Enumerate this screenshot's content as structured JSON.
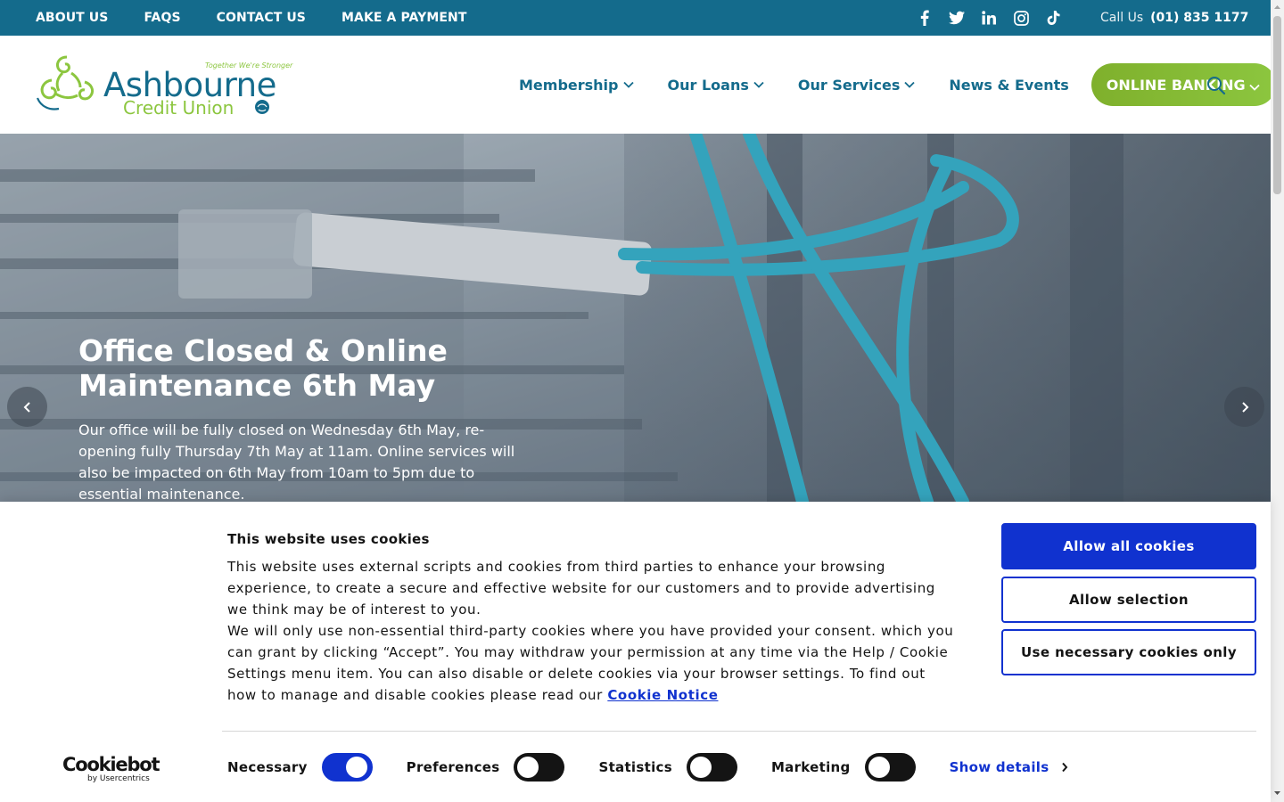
{
  "topbar": {
    "links": [
      "ABOUT US",
      "FAQS",
      "CONTACT US",
      "MAKE A PAYMENT"
    ],
    "social_icons": [
      "facebook-icon",
      "twitter-icon",
      "linkedin-icon",
      "instagram-icon",
      "tiktok-icon"
    ],
    "call_label": "Call Us",
    "call_number": "(01) 835 1177"
  },
  "logo": {
    "name": "Ashbourne",
    "subname": "Credit Union",
    "tagline": "Together We're Stronger"
  },
  "nav": {
    "items": [
      {
        "label": "Membership",
        "has_dropdown": true
      },
      {
        "label": "Our Loans",
        "has_dropdown": true
      },
      {
        "label": "Our Services",
        "has_dropdown": true
      },
      {
        "label": "News & Events",
        "has_dropdown": false
      }
    ],
    "cta": "ONLINE BANKING"
  },
  "hero": {
    "title": "Office Closed & Online Maintenance 6th May",
    "text": "Our office will be fully closed on Wednesday 6th May, re-opening fully Thursday 7th May at 11am. Online services will also be impacted on 6th May from 10am to 5pm due to essential maintenance."
  },
  "cookie": {
    "title": "This website uses cookies",
    "paragraph1": "This website uses external scripts and cookies from third parties to enhance your browsing experience, to create a secure and effective website for our customers and to provide advertising we think may be of interest to you.",
    "paragraph2": "We will only use non-essential third-party cookies where you have provided your consent. which you can grant by clicking “Accept”. You may withdraw your permission at any time via the Help / Cookie Settings menu item. You can also disable or delete cookies via your browser settings. To find out how to manage and disable cookies please read our",
    "notice_link": "Cookie Notice",
    "buttons": {
      "allow_all": "Allow all cookies",
      "allow_selection": "Allow selection",
      "necessary_only": "Use necessary cookies only"
    },
    "toggles": [
      {
        "label": "Necessary",
        "on": true
      },
      {
        "label": "Preferences",
        "on": false
      },
      {
        "label": "Statistics",
        "on": false
      },
      {
        "label": "Marketing",
        "on": false
      }
    ],
    "show_details": "Show details",
    "brand": "Cookiebot",
    "brand_sub": "by Usercentrics"
  },
  "colors": {
    "brand_teal": "#146b8c",
    "brand_green": "#8cc63f",
    "cookie_blue": "#1032cf"
  }
}
